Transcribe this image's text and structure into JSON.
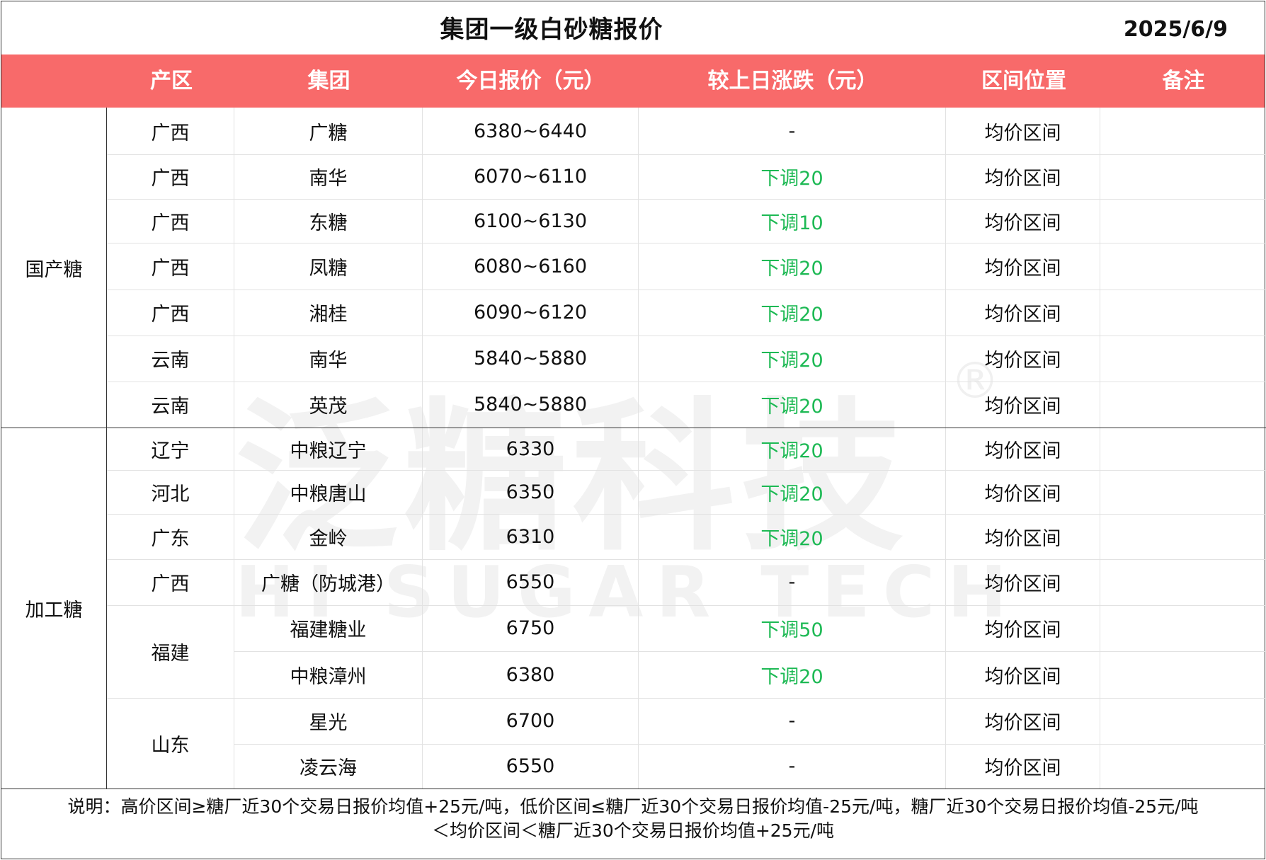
{
  "title": "集团一级白砂糖报价",
  "date": "2025/6/9",
  "headers": [
    "产区",
    "集团",
    "今日报价（元）",
    "较上日涨跌（元）",
    "区间位置",
    "备注"
  ],
  "categories": [
    "国产糖",
    "加工糖"
  ],
  "regions": [
    "广西",
    "广西",
    "广西",
    "广西",
    "广西",
    "云南",
    "云南",
    "辽宁",
    "河北",
    "广东",
    "广西",
    "福建",
    "山东"
  ],
  "rows": [
    {
      "group": "广糖",
      "price": "6380~6440",
      "change": "-",
      "position": "均价区间",
      "note": ""
    },
    {
      "group": "南华",
      "price": "6070~6110",
      "change": "下调20",
      "position": "均价区间",
      "note": ""
    },
    {
      "group": "东糖",
      "price": "6100~6130",
      "change": "下调10",
      "position": "均价区间",
      "note": ""
    },
    {
      "group": "凤糖",
      "price": "6080~6160",
      "change": "下调20",
      "position": "均价区间",
      "note": ""
    },
    {
      "group": "湘桂",
      "price": "6090~6120",
      "change": "下调20",
      "position": "均价区间",
      "note": ""
    },
    {
      "group": "南华",
      "price": "5840~5880",
      "change": "下调20",
      "position": "均价区间",
      "note": ""
    },
    {
      "group": "英茂",
      "price": "5840~5880",
      "change": "下调20",
      "position": "均价区间",
      "note": ""
    },
    {
      "group": "中粮辽宁",
      "price": "6330",
      "change": "下调20",
      "position": "均价区间",
      "note": ""
    },
    {
      "group": "中粮唐山",
      "price": "6350",
      "change": "下调20",
      "position": "均价区间",
      "note": ""
    },
    {
      "group": "金岭",
      "price": "6310",
      "change": "下调20",
      "position": "均价区间",
      "note": ""
    },
    {
      "group": "广糖（防城港）",
      "price": "6550",
      "change": "-",
      "position": "均价区间",
      "note": ""
    },
    {
      "group": "福建糖业",
      "price": "6750",
      "change": "下调50",
      "position": "均价区间",
      "note": ""
    },
    {
      "group": "中粮漳州",
      "price": "6380",
      "change": "下调20",
      "position": "均价区间",
      "note": ""
    },
    {
      "group": "星光",
      "price": "6700",
      "change": "-",
      "position": "均价区间",
      "note": ""
    },
    {
      "group": "凌云海",
      "price": "6550",
      "change": "-",
      "position": "均价区间",
      "note": ""
    }
  ],
  "watermark": {
    "cn": "泛糖科技",
    "en": "HI SUGAR TECH",
    "mark": "®"
  },
  "note_line1": "说明：高价区间≥糖厂近30个交易日报价均值+25元/吨，低价区间≤糖厂近30个交易日报价均值-25元/吨，糖厂近30个交易日报价均值-25元/吨",
  "note_line2": "＜均价区间＜糖厂近30个交易日报价均值+25元/吨",
  "colors": {
    "header_bg": "#f86a6a",
    "down": "#1db954"
  }
}
